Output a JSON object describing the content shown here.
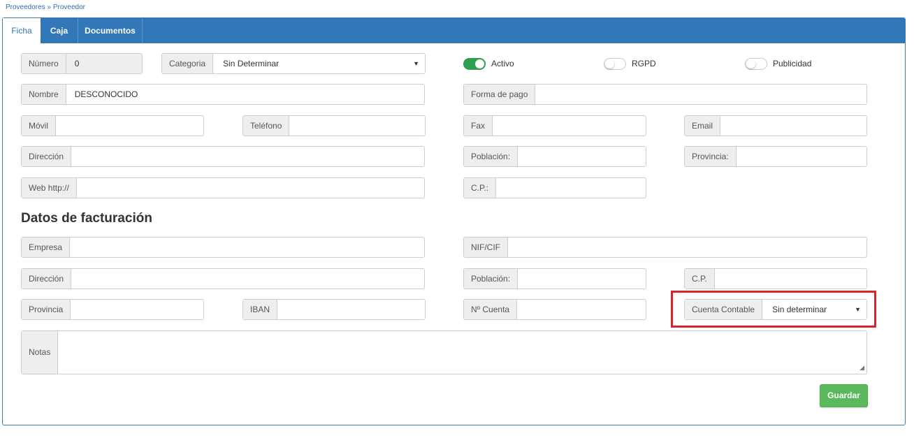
{
  "breadcrumb": {
    "parent": "Proveedores",
    "separator": " » ",
    "current": "Proveedor"
  },
  "tabs": [
    {
      "label": "Ficha",
      "active": true
    },
    {
      "label": "Caja",
      "active": false
    },
    {
      "label": "Documentos",
      "active": false
    }
  ],
  "general": {
    "numero": {
      "label": "Número",
      "value": "0"
    },
    "categoria": {
      "label": "Categoria",
      "value": "Sin Determinar"
    },
    "toggles": [
      {
        "label": "Activo",
        "on": true
      },
      {
        "label": "RGPD",
        "on": false
      },
      {
        "label": "Publicidad",
        "on": false
      }
    ],
    "nombre": {
      "label": "Nombre",
      "value": "DESCONOCIDO"
    },
    "forma_pago": {
      "label": "Forma de pago",
      "value": ""
    },
    "movil": {
      "label": "Móvil",
      "value": ""
    },
    "telefono": {
      "label": "Teléfono",
      "value": ""
    },
    "fax": {
      "label": "Fax",
      "value": ""
    },
    "email": {
      "label": "Email",
      "value": ""
    },
    "direccion": {
      "label": "Dirección",
      "value": ""
    },
    "poblacion": {
      "label": "Población:",
      "value": ""
    },
    "provincia": {
      "label": "Provincia:",
      "value": ""
    },
    "web": {
      "label": "Web http://",
      "value": ""
    },
    "cp": {
      "label": "C.P.:",
      "value": ""
    }
  },
  "billing": {
    "title": "Datos de facturación",
    "empresa": {
      "label": "Empresa",
      "value": ""
    },
    "nif": {
      "label": "NIF/CIF",
      "value": ""
    },
    "direccion": {
      "label": "Dirección",
      "value": ""
    },
    "poblacion": {
      "label": "Población:",
      "value": ""
    },
    "cp": {
      "label": "C.P.",
      "value": ""
    },
    "provincia": {
      "label": "Provincia",
      "value": ""
    },
    "iban": {
      "label": "IBAN",
      "value": ""
    },
    "n_cuenta": {
      "label": "Nº Cuenta",
      "value": ""
    },
    "cuenta_contable": {
      "label": "Cuenta Contable",
      "value": "Sin determinar"
    },
    "notas": {
      "label": "Notas",
      "value": ""
    }
  },
  "actions": {
    "save_label": "Guardar"
  },
  "icons": {
    "select_caret": "caret-down-icon",
    "resize": "resize-handle-icon"
  },
  "colors": {
    "brand": "#3277b8",
    "toggle_on": "#2e9e4f",
    "save": "#5cb85c",
    "highlight": "#d9232a"
  }
}
